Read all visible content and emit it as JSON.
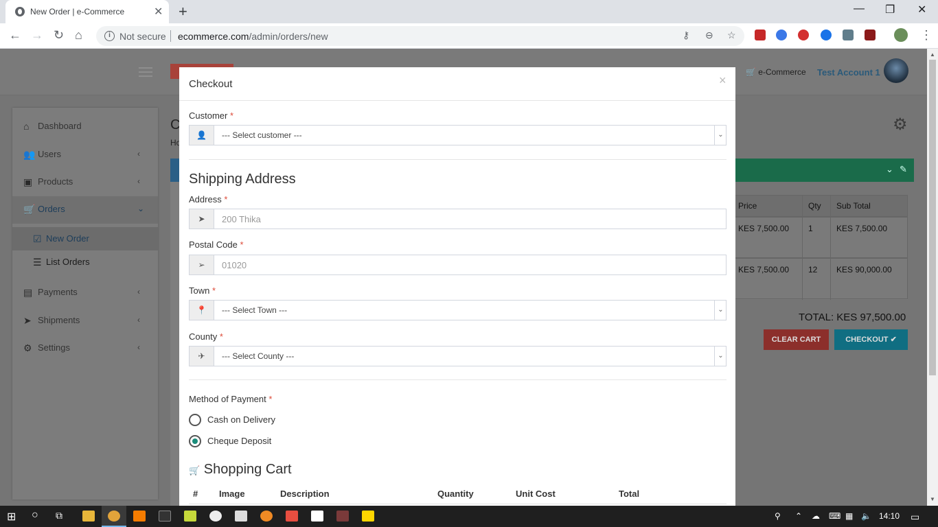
{
  "browser": {
    "tab_title": "New Order | e-Commerce",
    "not_secure": "Not secure",
    "url_domain": "ecommerce.com",
    "url_path": "/admin/orders/new"
  },
  "header": {
    "cart_label": "e-Commerce",
    "account_name": "Test Account 1"
  },
  "sidebar": {
    "items": [
      {
        "label": "Dashboard"
      },
      {
        "label": "Users"
      },
      {
        "label": "Products"
      },
      {
        "label": "Orders"
      },
      {
        "label": "Payments"
      },
      {
        "label": "Shipments"
      },
      {
        "label": "Settings"
      }
    ],
    "orders_sub": [
      {
        "label": "New Order"
      },
      {
        "label": "List Orders"
      }
    ]
  },
  "content": {
    "title_frag": "C",
    "breadcrumb_frag": "Ho"
  },
  "cart_table": {
    "headers": [
      "Price",
      "Qty",
      "Sub Total"
    ],
    "rows": [
      {
        "price": "KES 7,500.00",
        "qty": "1",
        "subtotal": "KES 7,500.00"
      },
      {
        "price": "KES 7,500.00",
        "qty": "12",
        "subtotal": "KES 90,000.00"
      }
    ],
    "total": "TOTAL: KES 97,500.00",
    "clear_label": "CLEAR CART",
    "checkout_label": "CHECKOUT"
  },
  "modal": {
    "title": "Checkout",
    "close": "×",
    "customer_label": "Customer",
    "customer_value": "--- Select customer ---",
    "shipping_title": "Shipping Address",
    "address_label": "Address",
    "address_placeholder": "200 Thika",
    "postal_label": "Postal Code",
    "postal_placeholder": "01020",
    "town_label": "Town",
    "town_value": "--- Select Town ---",
    "county_label": "County",
    "county_value": "--- Select County ---",
    "payment_label": "Method of Payment",
    "payment_options": [
      {
        "label": "Cash on Delivery",
        "selected": false
      },
      {
        "label": "Cheque Deposit",
        "selected": true
      }
    ],
    "cart_title": "Shopping Cart",
    "cart_columns": [
      "#",
      "Image",
      "Description",
      "Quantity",
      "Unit Cost",
      "Total"
    ],
    "required_mark": "*"
  },
  "taskbar": {
    "time": "14:10"
  },
  "colors": {
    "accent_green": "#00a65a",
    "accent_red": "#dd4b39",
    "accent_cyan": "#00c0ef",
    "radio_checked": "#1a8c7a"
  }
}
